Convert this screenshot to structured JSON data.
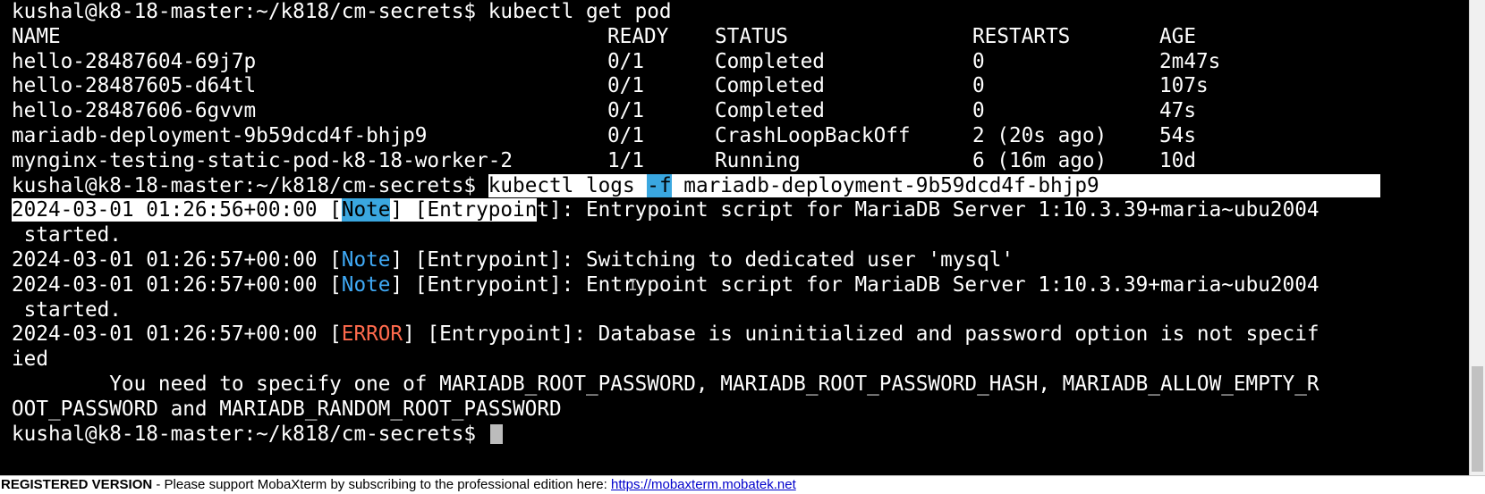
{
  "terminal": {
    "prompt": "kushal@k8-18-master:~/k818/cm-secrets$",
    "cmd1": " kubectl get pod",
    "table": {
      "headers": [
        "NAME",
        "READY",
        "STATUS",
        "RESTARTS",
        "AGE"
      ],
      "rows": [
        [
          "hello-28487604-69j7p",
          "0/1",
          "Completed",
          "0",
          "2m47s"
        ],
        [
          "hello-28487605-d64tl",
          "0/1",
          "Completed",
          "0",
          "107s"
        ],
        [
          "hello-28487606-6gvvm",
          "0/1",
          "Completed",
          "0",
          "47s"
        ],
        [
          "mariadb-deployment-9b59dcd4f-bhjp9",
          "0/1",
          "CrashLoopBackOff",
          "2 (20s ago)",
          "54s"
        ],
        [
          "mynginx-testing-static-pod-k8-18-worker-2",
          "1/1",
          "Running",
          "6 (16m ago)",
          "10d"
        ]
      ]
    },
    "cmd2": {
      "part1": "kubectl logs ",
      "flag": "-f",
      "part2": " mariadb-deployment-9b59dcd4f-bhjp9                       "
    },
    "log1": {
      "ts": "2024-03-01 01:26:56+00:00 ",
      "lb": "[",
      "level": "Note",
      "rb": "] ",
      "src_sel": "[Entrypoin",
      "src_rest": "t]",
      "msg": ": Entrypoint script for MariaDB Server 1:10.3.39+maria~ubu2004",
      "cont": " started."
    },
    "log2": {
      "ts": "2024-03-01 01:26:57+00:00 [",
      "level": "Note",
      "rest": "] [Entrypoint]: Switching to dedicated user 'mysql'"
    },
    "log3": {
      "ts": "2024-03-01 01:26:57+00:00 [",
      "level": "Note",
      "rest": "] [Entrypoint]: Entrypoint script for MariaDB Server 1:10.3.39+maria~ubu2004",
      "cont": " started."
    },
    "log4": {
      "ts": "2024-03-01 01:26:57+00:00 [",
      "level": "ERROR",
      "rest": "] [Entrypoint]: Database is uninitialized and password option is not specif",
      "cont": "ied",
      "detail1": "        You need to specify one of MARIADB_ROOT_PASSWORD, MARIADB_ROOT_PASSWORD_HASH, MARIADB_ALLOW_EMPTY_R",
      "detail2": "OOT_PASSWORD and MARIADB_RANDOM_ROOT_PASSWORD"
    },
    "final_prompt": "kushal@k8-18-master:~/k818/cm-secrets$ "
  },
  "statusbar": {
    "registered": "REGISTERED VERSION",
    "message": "  -  Please support MobaXterm by subscribing to the professional edition here:  ",
    "link": "https://mobaxterm.mobatek.net"
  },
  "colors": {
    "background": "#000000",
    "foreground": "#ffffff",
    "note": "#3fa9f5",
    "error": "#ff6a4d",
    "selection": "#ffffff",
    "selection_highlight": "#3aa7e0"
  }
}
